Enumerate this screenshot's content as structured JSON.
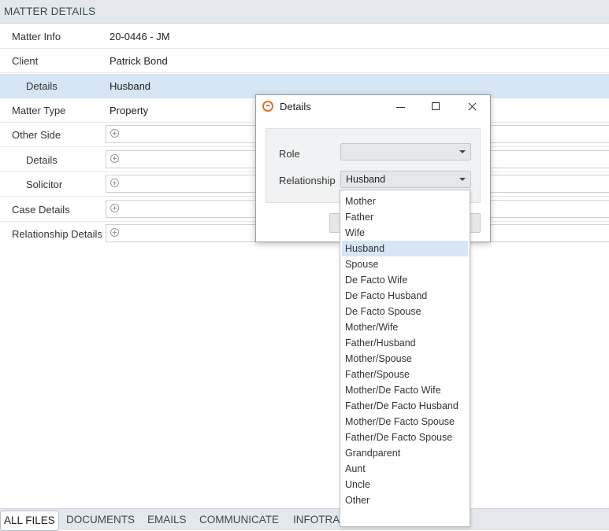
{
  "header": {
    "title": "MATTER DETAILS"
  },
  "rows": [
    {
      "label": "Matter Info",
      "value": "20-0446 - JM"
    },
    {
      "label": "Client",
      "value": "Patrick Bond"
    },
    {
      "label": "Details",
      "value": "Husband"
    },
    {
      "label": "Matter Type",
      "value": "Property"
    },
    {
      "label": "Other Side"
    },
    {
      "label": "Details"
    },
    {
      "label": "Solicitor"
    },
    {
      "label": "Case Details"
    },
    {
      "label": "Relationship Details"
    }
  ],
  "tabs": [
    "ALL FILES",
    "DOCUMENTS",
    "EMAILS",
    "COMMUNICATE",
    "INFOTRAC"
  ],
  "dialog": {
    "title": "Details",
    "role_label": "Role",
    "role_value": "",
    "relationship_label": "Relationship",
    "relationship_value": "Husband"
  },
  "dropdown": {
    "selected": "Husband",
    "options": [
      "Mother",
      "Father",
      "Wife",
      "Husband",
      "Spouse",
      "De Facto Wife",
      "De Facto Husband",
      "De Facto Spouse",
      "Mother/Wife",
      "Father/Husband",
      "Mother/Spouse",
      "Father/Spouse",
      "Mother/De Facto Wife",
      "Father/De Facto Husband",
      "Mother/De Facto Spouse",
      "Father/De Facto Spouse",
      "Grandparent",
      "Aunt",
      "Uncle",
      "Other"
    ]
  },
  "colors": {
    "selection": "#d6e6f5",
    "header_bg": "#e4e8ec",
    "brand_orange": "#e0702a"
  },
  "icons": [
    "app-logo-icon",
    "minimize-icon",
    "maximize-icon",
    "close-icon",
    "chevron-down-icon",
    "add-icon"
  ]
}
